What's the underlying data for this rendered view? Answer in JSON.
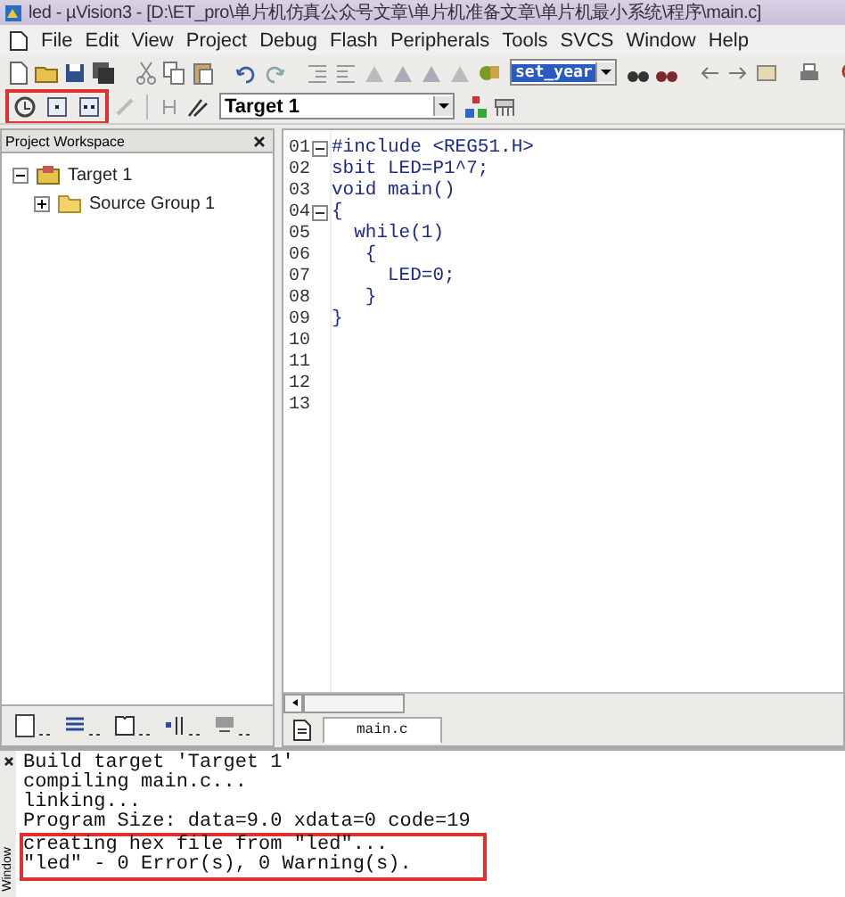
{
  "window": {
    "title": "led - µVision3 - [D:\\ET_pro\\单片机仿真公众号文章\\单片机准备文章\\单片机最小系统\\程序\\main.c]"
  },
  "menu": [
    "File",
    "Edit",
    "View",
    "Project",
    "Debug",
    "Flash",
    "Peripherals",
    "Tools",
    "SVCS",
    "Window",
    "Help"
  ],
  "find_combo": {
    "value": "set_year"
  },
  "target_combo": {
    "value": "Target 1"
  },
  "workspace": {
    "title": "Project Workspace",
    "tree": [
      {
        "label": "Target 1",
        "expanded": true,
        "children": [
          {
            "label": "Source Group 1",
            "expanded": false
          }
        ]
      }
    ]
  },
  "editor": {
    "tabs": [
      {
        "label": "main.c",
        "selected": true
      }
    ],
    "lines": [
      {
        "number": "01",
        "code": "#include <REG51.H>",
        "fold": true
      },
      {
        "number": "02",
        "code": "sbit LED=P1^7;",
        "fold": false
      },
      {
        "number": "03",
        "code": "void main()",
        "fold": false
      },
      {
        "number": "04",
        "code": "{",
        "fold": true
      },
      {
        "number": "05",
        "code": "  while(1)",
        "fold": false
      },
      {
        "number": "06",
        "code": "   {",
        "fold": false
      },
      {
        "number": "07",
        "code": "     LED=0;",
        "fold": false
      },
      {
        "number": "08",
        "code": "   }",
        "fold": false
      },
      {
        "number": "09",
        "code": "}",
        "fold": false
      },
      {
        "number": "10",
        "fold": false
      },
      {
        "number": "11",
        "fold": false
      },
      {
        "number": "12",
        "fold": false
      },
      {
        "number": "13",
        "fold": false
      }
    ]
  },
  "output": {
    "side_label": "Window",
    "lines": [
      {
        "text": "Build target 'Target 1'",
        "highlighted": false
      },
      {
        "text": "compiling main.c...",
        "highlighted": false
      },
      {
        "text": "linking...",
        "highlighted": false
      },
      {
        "text": "Program Size: data=9.0 xdata=0 code=19",
        "highlighted": false
      },
      {
        "text": "creating hex file from \"led\"...",
        "highlighted": true
      },
      {
        "text": "\"led\" - 0 Error(s), 0 Warning(s).",
        "highlighted": true
      }
    ]
  }
}
